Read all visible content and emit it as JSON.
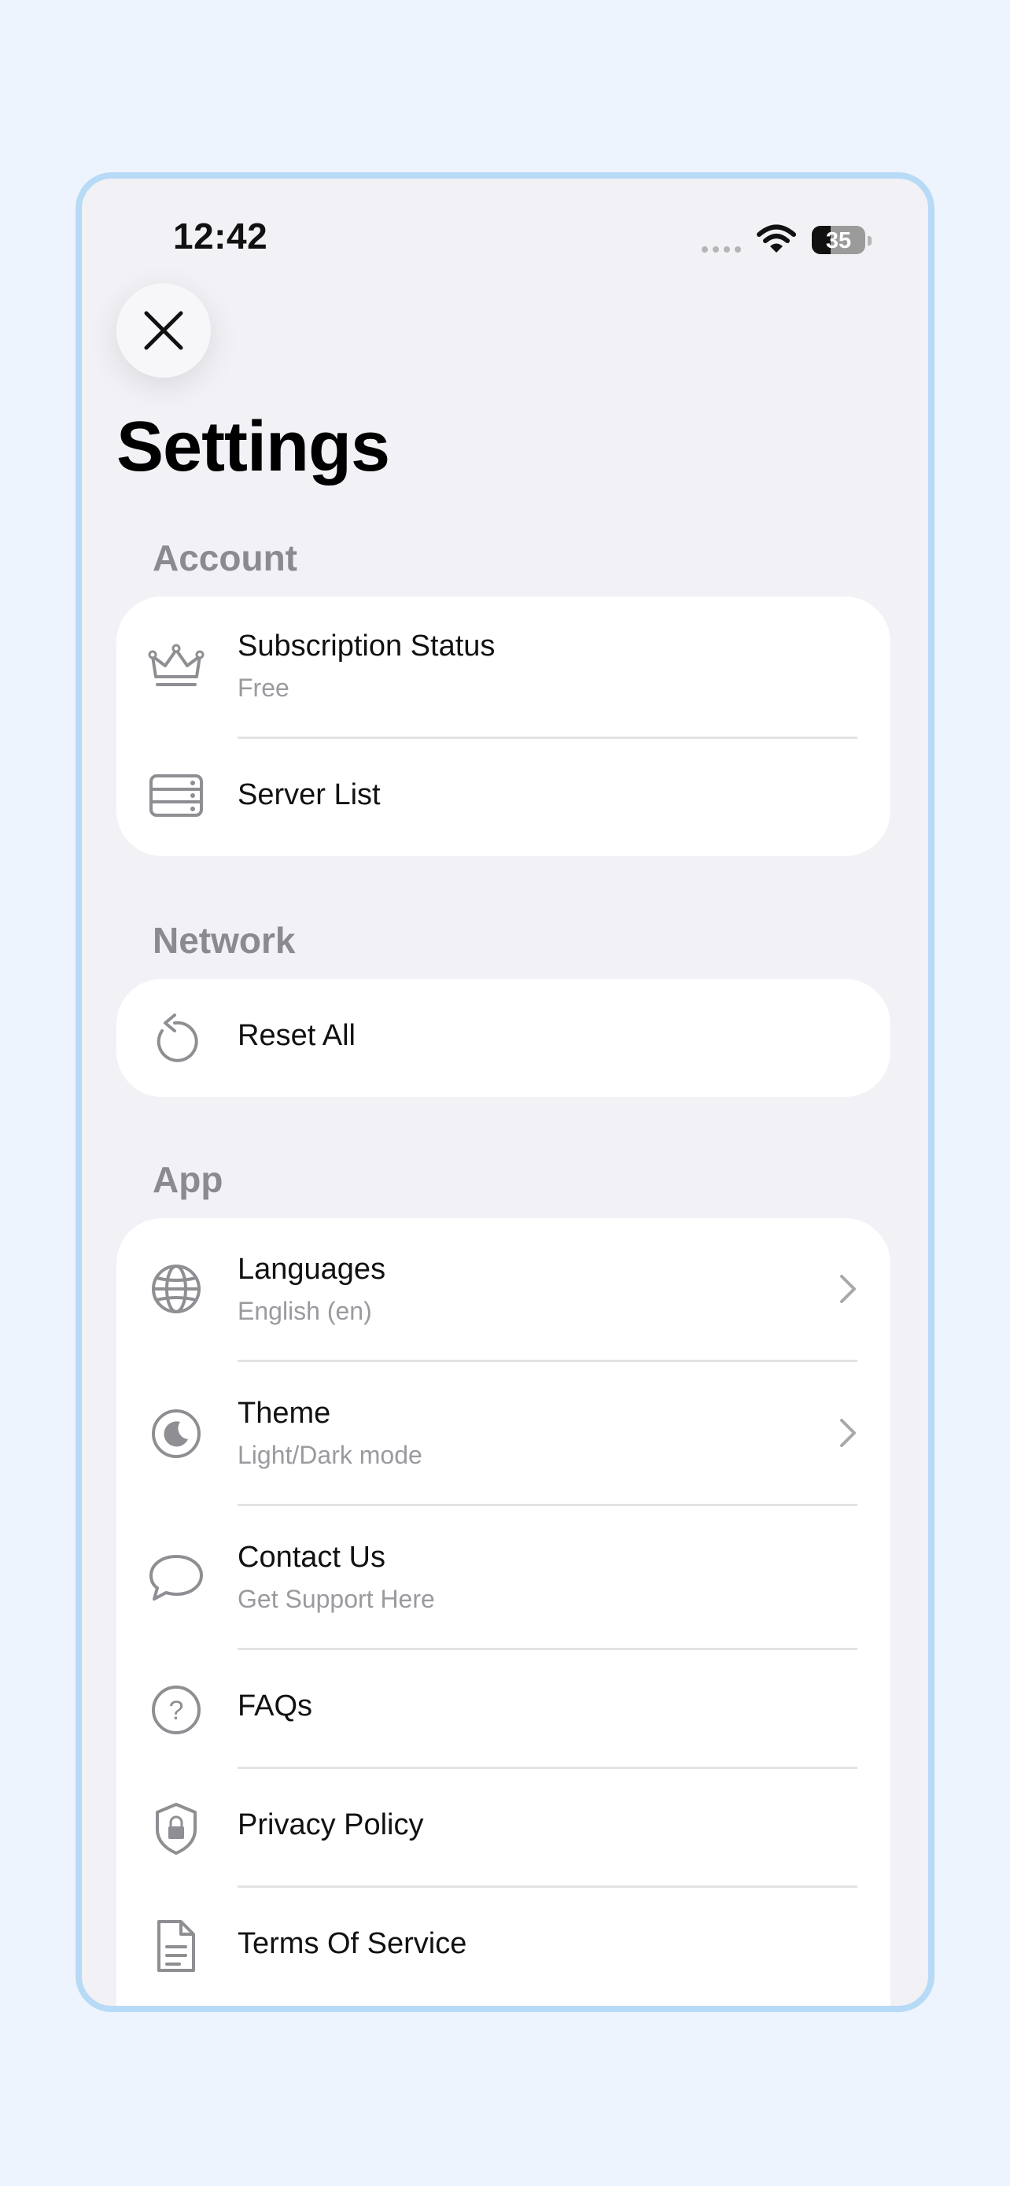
{
  "status_bar": {
    "time": "12:42",
    "battery": "35"
  },
  "close_button": {
    "icon": "close-icon"
  },
  "page": {
    "title": "Settings"
  },
  "sections": {
    "account": {
      "header": "Account",
      "items": [
        {
          "icon": "crown-icon",
          "title": "Subscription Status",
          "subtitle": "Free"
        },
        {
          "icon": "server-icon",
          "title": "Server List"
        }
      ]
    },
    "network": {
      "header": "Network",
      "items": [
        {
          "icon": "reset-icon",
          "title": "Reset All"
        }
      ]
    },
    "app": {
      "header": "App",
      "items": [
        {
          "icon": "globe-icon",
          "title": "Languages",
          "subtitle": "English (en)",
          "chevron": true
        },
        {
          "icon": "moon-icon",
          "title": "Theme",
          "subtitle": "Light/Dark mode",
          "chevron": true
        },
        {
          "icon": "chat-bubble-icon",
          "title": "Contact Us",
          "subtitle": "Get Support Here"
        },
        {
          "icon": "question-icon",
          "title": "FAQs"
        },
        {
          "icon": "shield-lock-icon",
          "title": "Privacy Policy"
        },
        {
          "icon": "document-icon",
          "title": "Terms Of Service"
        }
      ]
    }
  },
  "colors": {
    "page_background": "#EEF4FD",
    "device_border": "#B7DAF6",
    "screen_background": "#F2F1F6",
    "section_header": "#8A8A8F",
    "icon_gray": "#8E8E93"
  }
}
